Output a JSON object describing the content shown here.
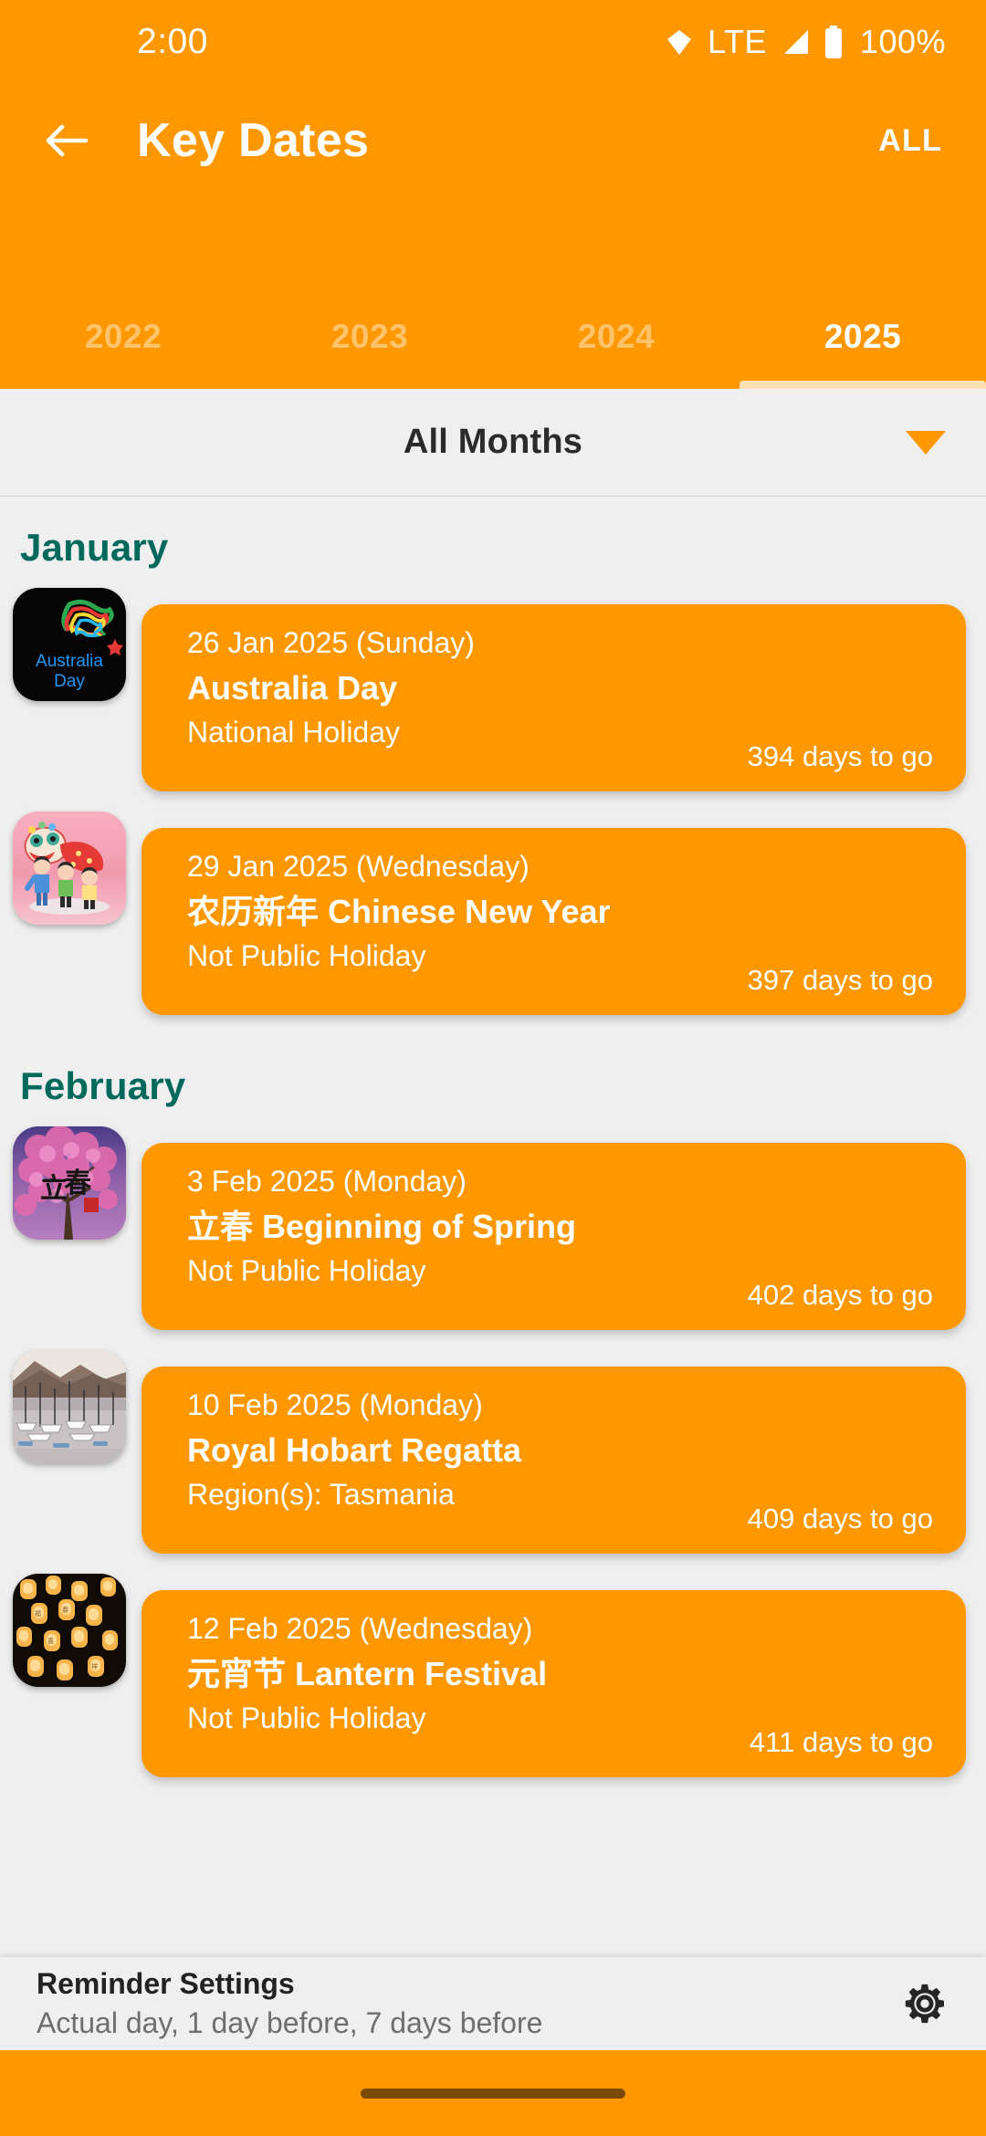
{
  "status_bar": {
    "time": "2:00",
    "network_type": "LTE",
    "battery_percent": "100%",
    "icons": [
      "wifi-icon",
      "signal-icon",
      "battery-icon"
    ]
  },
  "app_bar": {
    "back_label": "back-arrow-icon",
    "title": "Key Dates",
    "action_label": "ALL"
  },
  "year_tabs": {
    "items": [
      {
        "label": "2022",
        "active": false
      },
      {
        "label": "2023",
        "active": false
      },
      {
        "label": "2024",
        "active": false
      },
      {
        "label": "2025",
        "active": true
      }
    ],
    "selected": "2025"
  },
  "month_filter": {
    "label": "All Months",
    "caret": "chevron-down-icon"
  },
  "sections": [
    {
      "month": "January",
      "events": [
        {
          "date": "26 Jan 2025 (Sunday)",
          "title": "Australia Day",
          "subtitle": "National Holiday",
          "countdown": "394 days to go",
          "thumb": "australia-day-logo"
        },
        {
          "date": "29 Jan 2025 (Wednesday)",
          "title": "农历新年 Chinese New Year",
          "subtitle": "Not Public Holiday",
          "countdown": "397 days to go",
          "thumb": "lion-dance-photo"
        }
      ]
    },
    {
      "month": "February",
      "events": [
        {
          "date": "3 Feb 2025 (Monday)",
          "title": "立春 Beginning of Spring",
          "subtitle": "Not Public Holiday",
          "countdown": "402 days to go",
          "thumb": "cherry-blossom-photo"
        },
        {
          "date": "10 Feb 2025 (Monday)",
          "title": "Royal Hobart Regatta",
          "subtitle": "Region(s): Tasmania",
          "countdown": "409 days to go",
          "thumb": "harbour-boats-photo"
        },
        {
          "date": "12 Feb 2025 (Wednesday)",
          "title": "元宵节 Lantern Festival",
          "subtitle": "Not Public Holiday",
          "countdown": "411 days to go",
          "thumb": "sky-lanterns-photo"
        }
      ]
    }
  ],
  "reminder_bar": {
    "title": "Reminder Settings",
    "subtitle": "Actual day, 1 day before, 7 days before",
    "gear": "gear-icon"
  },
  "colors": {
    "accent_orange": "#FF9800",
    "tab_indicator": "#FFE0B2",
    "month_header_teal": "#00695C",
    "page_background": "#EFEFEF",
    "nav_home_indicator": "#7A4A00"
  }
}
